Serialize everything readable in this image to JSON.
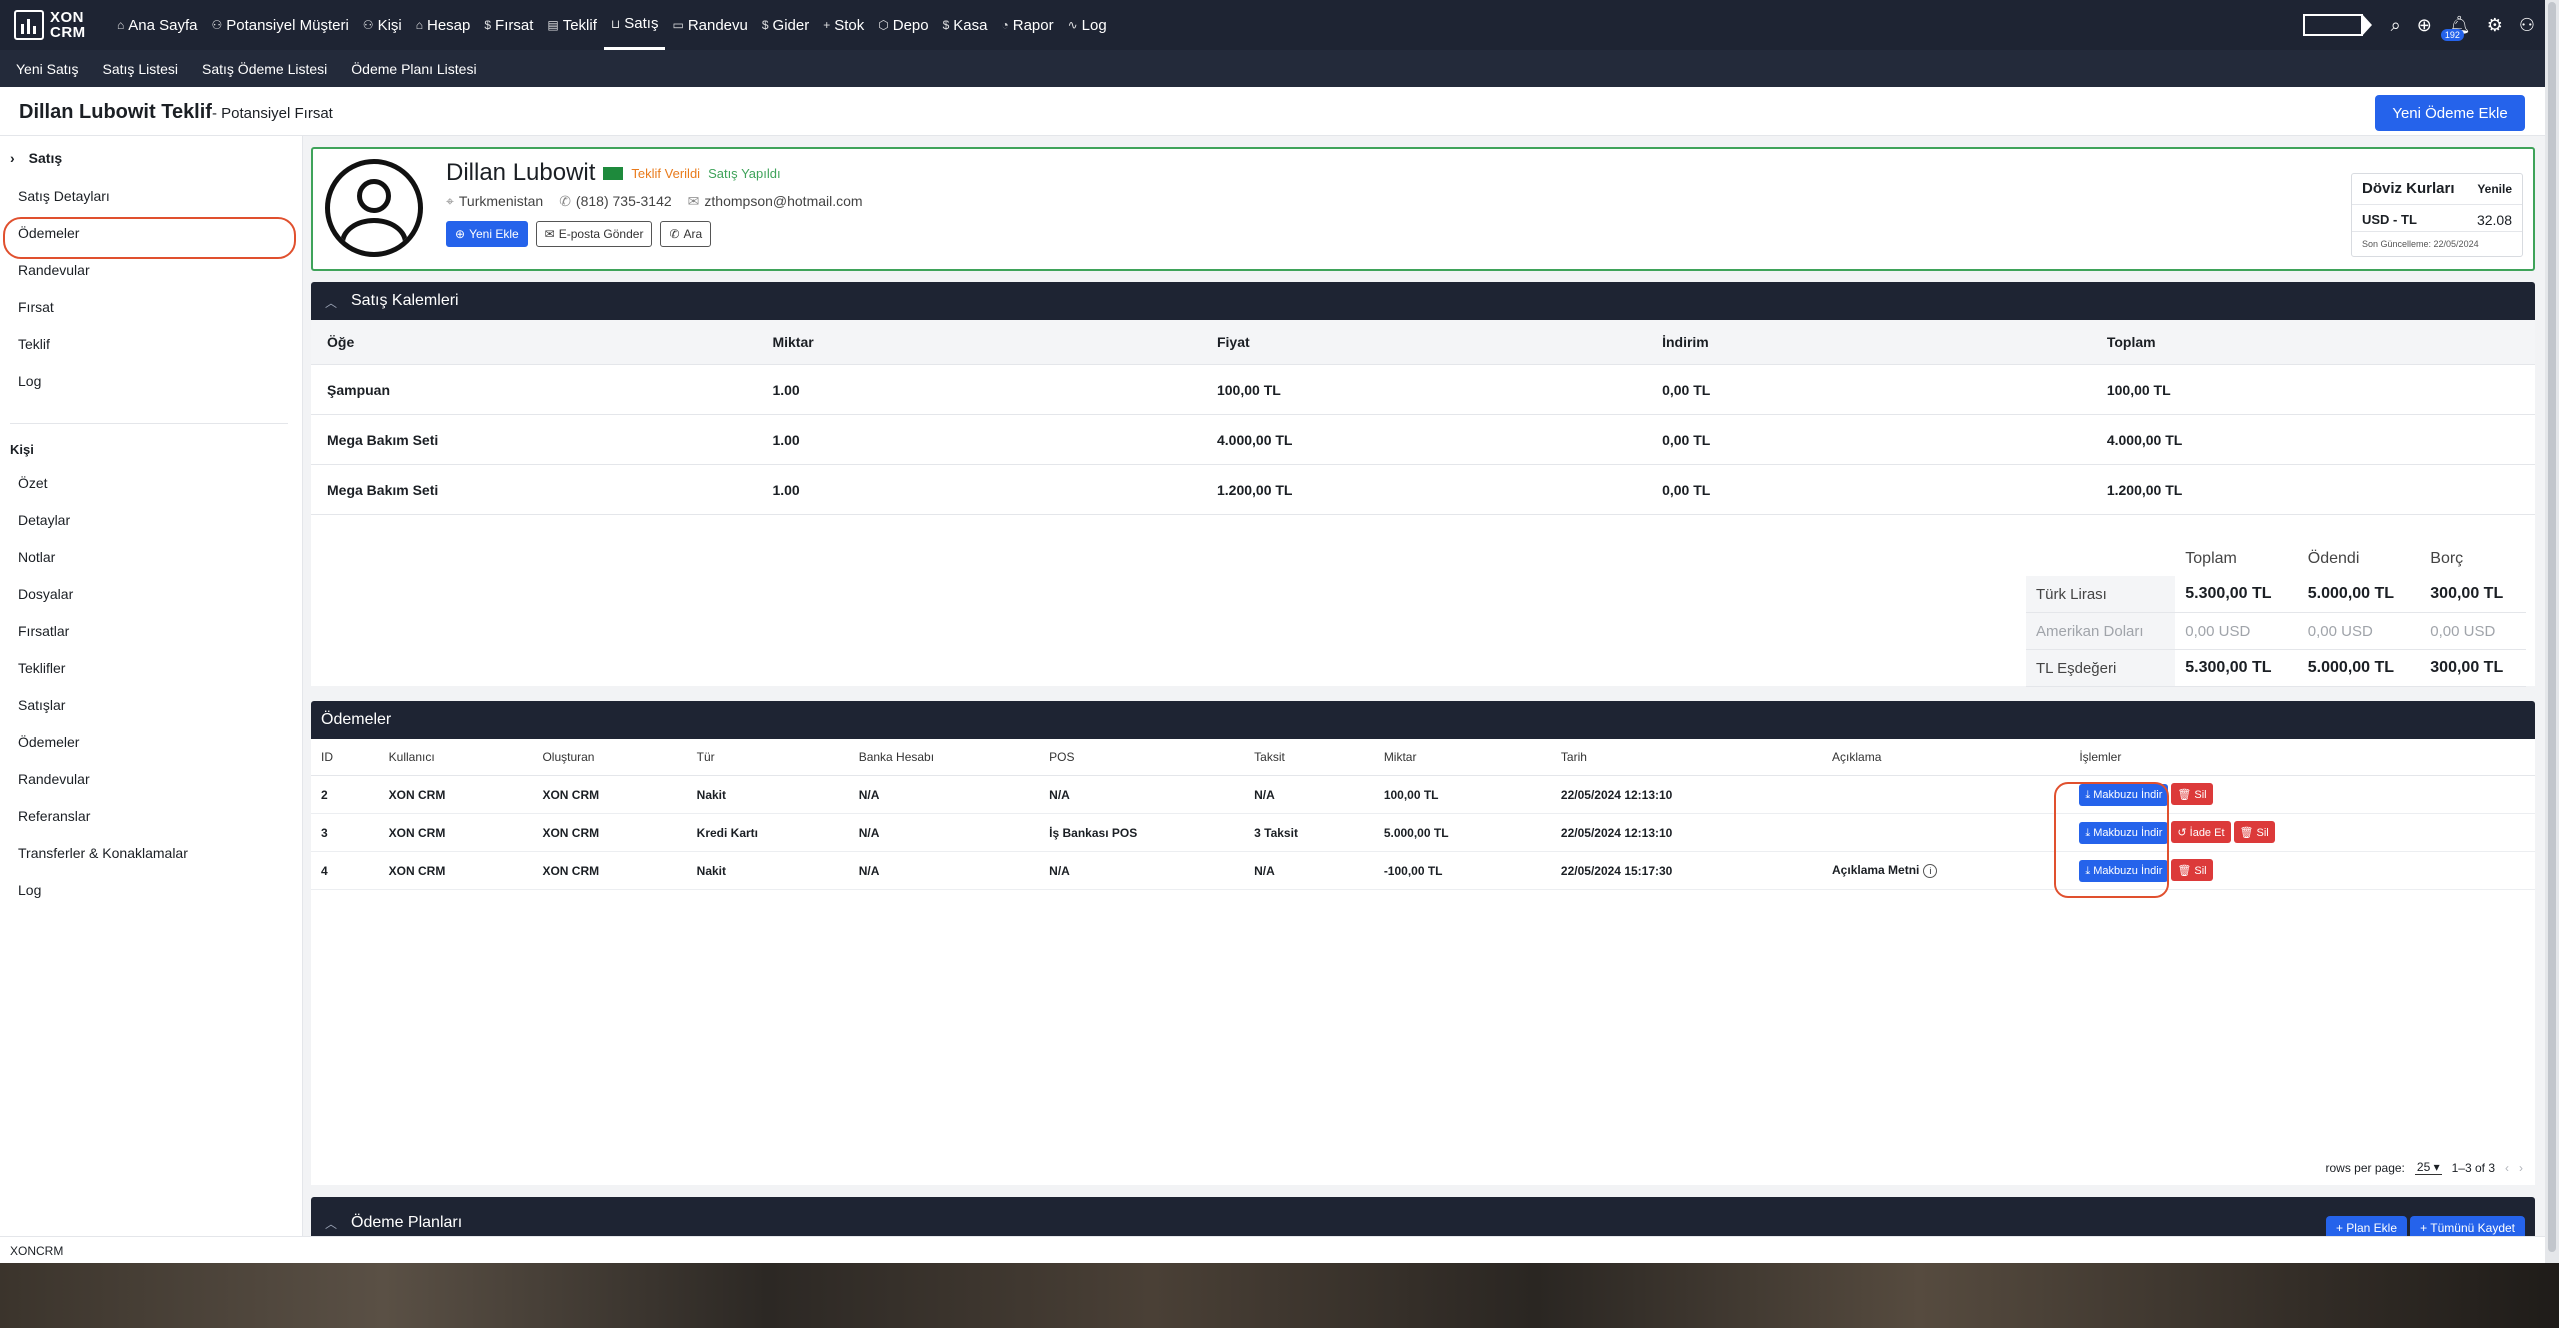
{
  "brand": {
    "line1": "XON",
    "line2": "CRM"
  },
  "nav": {
    "items": [
      {
        "icon": "⌂",
        "label": "Ana Sayfa"
      },
      {
        "icon": "⚇",
        "label": "Potansiyel Müşteri"
      },
      {
        "icon": "⚇",
        "label": "Kişi"
      },
      {
        "icon": "⌂",
        "label": "Hesap"
      },
      {
        "icon": "$",
        "label": "Fırsat"
      },
      {
        "icon": "▤",
        "label": "Teklif"
      },
      {
        "icon": "⊔",
        "label": "Satış"
      },
      {
        "icon": "▭",
        "label": "Randevu"
      },
      {
        "icon": "$",
        "label": "Gider"
      },
      {
        "icon": "+",
        "label": "Stok"
      },
      {
        "icon": "⬡",
        "label": "Depo"
      },
      {
        "icon": "$",
        "label": "Kasa"
      },
      {
        "icon": "◔",
        "label": "Rapor"
      },
      {
        "icon": "∿",
        "label": "Log"
      }
    ],
    "notification_count": "192"
  },
  "subnav": [
    "Yeni Satış",
    "Satış Listesi",
    "Satış Ödeme Listesi",
    "Ödeme Planı Listesi"
  ],
  "page": {
    "title": "Dillan Lubowit Teklif",
    "subtitle": "- Potansiyel Fırsat",
    "new_payment_button": "Yeni Ödeme Ekle"
  },
  "sidebar": {
    "header": "Satış",
    "sale_items": [
      "Satış Detayları",
      "Ödemeler",
      "Randevular",
      "Fırsat",
      "Teklif",
      "Log"
    ],
    "section_person": "Kişi",
    "person_items": [
      "Özet",
      "Detaylar",
      "Notlar",
      "Dosyalar",
      "Fırsatlar",
      "Teklifler",
      "Satışlar",
      "Ödemeler",
      "Randevular",
      "Referanslar",
      "Transferler & Konaklamalar",
      "Log"
    ]
  },
  "customer": {
    "name": "Dillan Lubowit",
    "status1": "Teklif Verildi",
    "status2": "Satış Yapıldı",
    "country": "Turkmenistan",
    "phone": "(818) 735-3142",
    "email": "zthompson@hotmail.com",
    "btn_new": "Yeni Ekle",
    "btn_email": "E-posta Gönder",
    "btn_call": "Ara"
  },
  "fx": {
    "title": "Döviz Kurları",
    "refresh": "Yenile",
    "pair": "USD - TL",
    "rate": "32.08",
    "updated": "Son Güncelleme: 22/05/2024"
  },
  "items_panel": {
    "title": "Satış Kalemleri",
    "headers": [
      "Öğe",
      "Miktar",
      "Fiyat",
      "İndirim",
      "Toplam"
    ],
    "rows": [
      [
        "Şampuan",
        "1.00",
        "100,00 TL",
        "0,00 TL",
        "100,00 TL"
      ],
      [
        "Mega Bakım Seti",
        "1.00",
        "4.000,00 TL",
        "0,00 TL",
        "4.000,00 TL"
      ],
      [
        "Mega Bakım Seti",
        "1.00",
        "1.200,00 TL",
        "0,00 TL",
        "1.200,00 TL"
      ]
    ],
    "totals": {
      "headers": [
        "Toplam",
        "Ödendi",
        "Borç"
      ],
      "rows": [
        {
          "label": "Türk Lirası",
          "values": [
            "5.300,00 TL",
            "5.000,00 TL",
            "300,00 TL"
          ]
        },
        {
          "label": "Amerikan Doları",
          "values": [
            "0,00 USD",
            "0,00 USD",
            "0,00 USD"
          ]
        },
        {
          "label": "TL Eşdeğeri",
          "values": [
            "5.300,00 TL",
            "5.000,00 TL",
            "300,00 TL"
          ]
        }
      ]
    }
  },
  "payments_panel": {
    "title": "Ödemeler",
    "headers": [
      "ID",
      "Kullanıcı",
      "Oluşturan",
      "Tür",
      "Banka Hesabı",
      "POS",
      "Taksit",
      "Miktar",
      "Tarih",
      "Açıklama",
      "İşlemler"
    ],
    "rows": [
      [
        "2",
        "XON CRM",
        "XON CRM",
        "Nakit",
        "N/A",
        "N/A",
        "N/A",
        "100,00 TL",
        "22/05/2024 12:13:10",
        ""
      ],
      [
        "3",
        "XON CRM",
        "XON CRM",
        "Kredi Kartı",
        "N/A",
        "İş Bankası POS",
        "3 Taksit",
        "5.000,00 TL",
        "22/05/2024 12:13:10",
        ""
      ],
      [
        "4",
        "XON CRM",
        "XON CRM",
        "Nakit",
        "N/A",
        "N/A",
        "N/A",
        "-100,00 TL",
        "22/05/2024 15:17:30",
        "Açıklama Metni"
      ]
    ],
    "btn_receipt": "Makbuzu İndir",
    "btn_delete": "Sil",
    "btn_refund": "İade Et",
    "rows_per_page_label": "rows per page:",
    "rows_per_page": "25",
    "range": "1–3 of 3"
  },
  "plans_panel": {
    "title": "Ödeme Planları",
    "btn_add": "Plan Ekle",
    "btn_save_all": "Tümünü Kaydet"
  },
  "footer": "XONCRM"
}
